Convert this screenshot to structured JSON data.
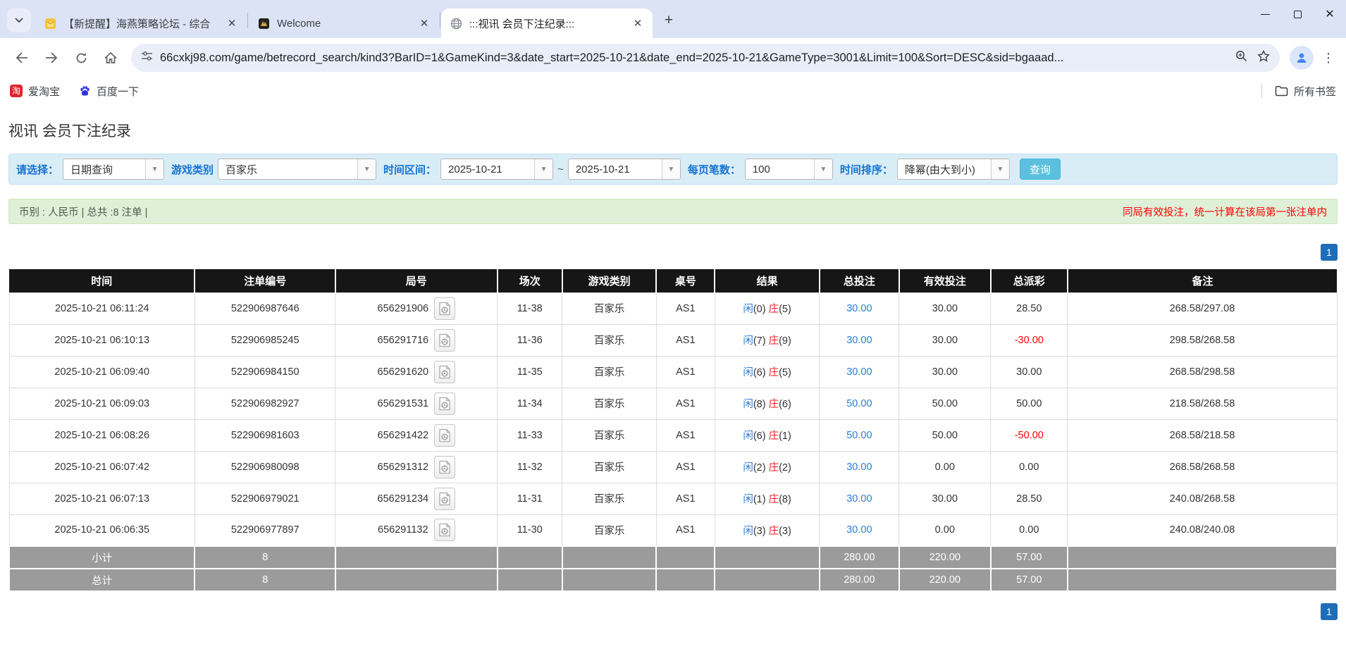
{
  "browser": {
    "tabs": [
      {
        "title": "【新提醒】海燕策略论坛 - 综合",
        "icon": "forum-favicon"
      },
      {
        "title": "Welcome",
        "icon": "app-favicon"
      },
      {
        "title": ":::视讯 会员下注纪录:::",
        "icon": "globe-favicon"
      }
    ],
    "url": "66cxkj98.com/game/betrecord_search/kind3?BarID=1&GameKind=3&date_start=2025-10-21&date_end=2025-10-21&GameType=3001&Limit=100&Sort=DESC&sid=bgaaad...",
    "bookmarks": [
      "爱淘宝",
      "百度一下"
    ],
    "all_bookmarks_label": "所有书签",
    "taobao_glyph": "淘"
  },
  "page": {
    "title": "视讯 会员下注纪录",
    "filters": {
      "select_label": "请选择：",
      "select_value": "日期查询",
      "game_type_label": "游戏类别",
      "game_type_value": "百家乐",
      "date_range_label": "时间区间：",
      "date_start": "2025-10-21",
      "tilde": "~",
      "date_end": "2025-10-21",
      "per_page_label": "每页笔数：",
      "per_page_value": "100",
      "sort_label": "时间排序：",
      "sort_value": "降幂(由大到小)",
      "search_label": "查询"
    },
    "summary_left": "币别 : 人民币 | 总共 :8 注单 |",
    "summary_right": "同局有效投注，统一计算在该局第一张注单内",
    "pagination": "1",
    "table": {
      "col_widths": [
        "14%",
        "10.6%",
        "12.2%",
        "4.9%",
        "7.1%",
        "4.4%",
        "7.9%",
        "6%",
        "6.9%",
        "5.8%",
        "20.3%"
      ],
      "headers": [
        "时间",
        "注单编号",
        "局号",
        "场次",
        "游戏类别",
        "桌号",
        "结果",
        "总投注",
        "有效投注",
        "总派彩",
        "备注"
      ],
      "rows": [
        {
          "time": "2025-10-21 06:11:24",
          "bet_id": "522906987646",
          "round_id": "656291906",
          "session": "11-38",
          "game": "百家乐",
          "table": "AS1",
          "result": {
            "p": "闲",
            "pn": "(0)",
            "b": "庄",
            "bn": "(5)"
          },
          "total_bet": "30.00",
          "valid_bet": "30.00",
          "payout": "28.50",
          "note": "268.58/297.08"
        },
        {
          "time": "2025-10-21 06:10:13",
          "bet_id": "522906985245",
          "round_id": "656291716",
          "session": "11-36",
          "game": "百家乐",
          "table": "AS1",
          "result": {
            "p": "闲",
            "pn": "(7)",
            "b": "庄",
            "bn": "(9)"
          },
          "total_bet": "30.00",
          "valid_bet": "30.00",
          "payout": "-30.00",
          "note": "298.58/268.58"
        },
        {
          "time": "2025-10-21 06:09:40",
          "bet_id": "522906984150",
          "round_id": "656291620",
          "session": "11-35",
          "game": "百家乐",
          "table": "AS1",
          "result": {
            "p": "闲",
            "pn": "(6)",
            "b": "庄",
            "bn": "(5)"
          },
          "total_bet": "30.00",
          "valid_bet": "30.00",
          "payout": "30.00",
          "note": "268.58/298.58"
        },
        {
          "time": "2025-10-21 06:09:03",
          "bet_id": "522906982927",
          "round_id": "656291531",
          "session": "11-34",
          "game": "百家乐",
          "table": "AS1",
          "result": {
            "p": "闲",
            "pn": "(8)",
            "b": "庄",
            "bn": "(6)"
          },
          "total_bet": "50.00",
          "valid_bet": "50.00",
          "payout": "50.00",
          "note": "218.58/268.58"
        },
        {
          "time": "2025-10-21 06:08:26",
          "bet_id": "522906981603",
          "round_id": "656291422",
          "session": "11-33",
          "game": "百家乐",
          "table": "AS1",
          "result": {
            "p": "闲",
            "pn": "(6)",
            "b": "庄",
            "bn": "(1)"
          },
          "total_bet": "50.00",
          "valid_bet": "50.00",
          "payout": "-50.00",
          "note": "268.58/218.58"
        },
        {
          "time": "2025-10-21 06:07:42",
          "bet_id": "522906980098",
          "round_id": "656291312",
          "session": "11-32",
          "game": "百家乐",
          "table": "AS1",
          "result": {
            "p": "闲",
            "pn": "(2)",
            "b": "庄",
            "bn": "(2)"
          },
          "total_bet": "30.00",
          "valid_bet": "0.00",
          "payout": "0.00",
          "note": "268.58/268.58"
        },
        {
          "time": "2025-10-21 06:07:13",
          "bet_id": "522906979021",
          "round_id": "656291234",
          "session": "11-31",
          "game": "百家乐",
          "table": "AS1",
          "result": {
            "p": "闲",
            "pn": "(1)",
            "b": "庄",
            "bn": "(8)"
          },
          "total_bet": "30.00",
          "valid_bet": "30.00",
          "payout": "28.50",
          "note": "240.08/268.58"
        },
        {
          "time": "2025-10-21 06:06:35",
          "bet_id": "522906977897",
          "round_id": "656291132",
          "session": "11-30",
          "game": "百家乐",
          "table": "AS1",
          "result": {
            "p": "闲",
            "pn": "(3)",
            "b": "庄",
            "bn": "(3)"
          },
          "total_bet": "30.00",
          "valid_bet": "0.00",
          "payout": "0.00",
          "note": "240.08/240.08"
        }
      ],
      "subtotal": {
        "label": "小计",
        "count": "8",
        "total_bet": "280.00",
        "valid_bet": "220.00",
        "payout": "57.00"
      },
      "total": {
        "label": "总计",
        "count": "8",
        "total_bet": "280.00",
        "valid_bet": "220.00",
        "payout": "57.00"
      }
    }
  }
}
